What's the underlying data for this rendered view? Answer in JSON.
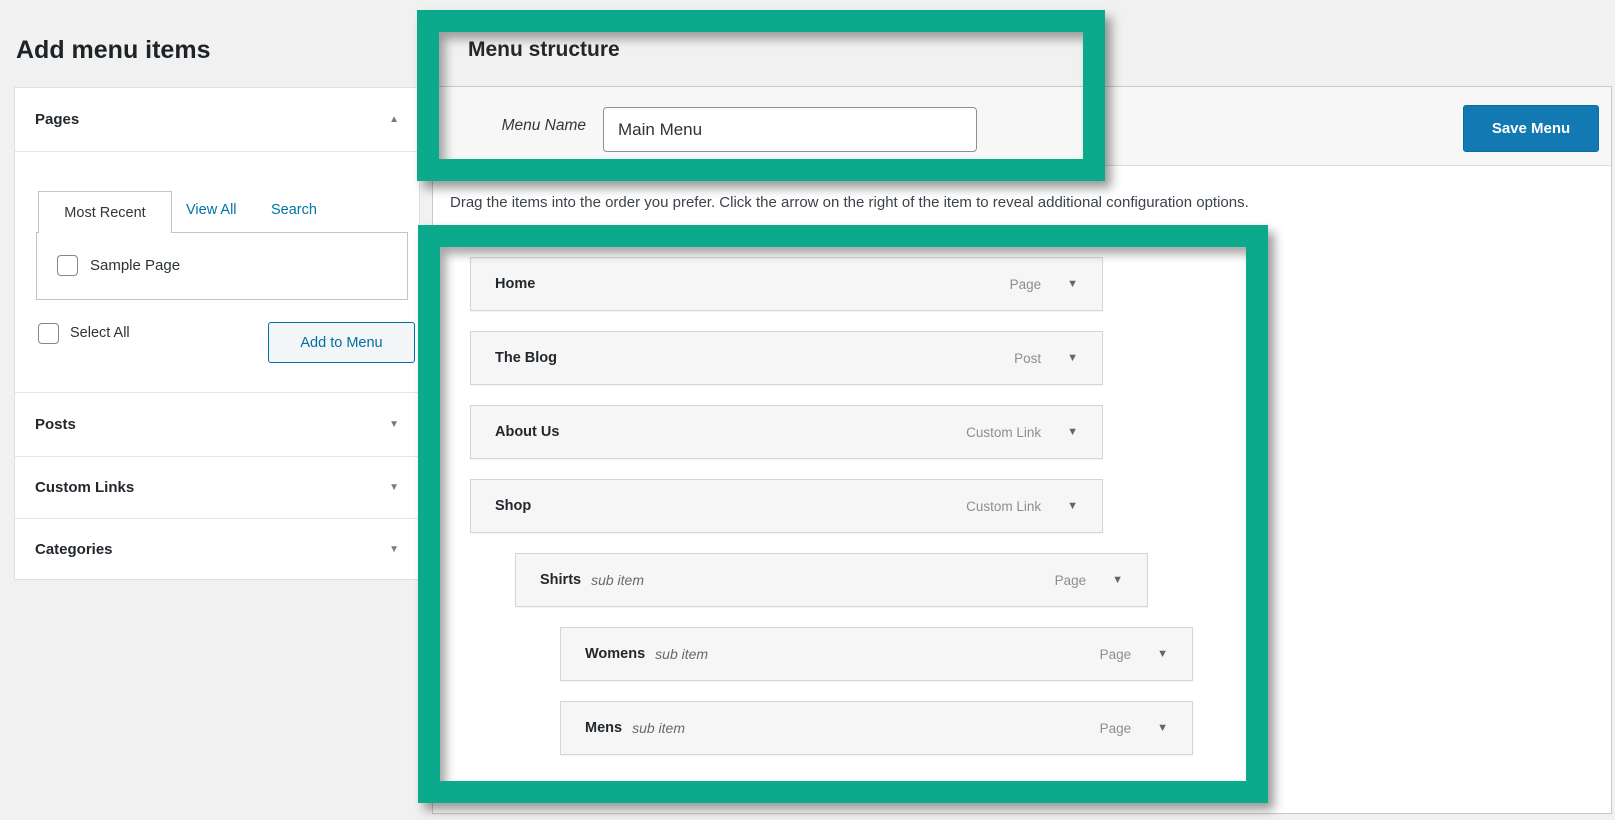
{
  "colors": {
    "highlight_green": "#0caa8c",
    "primary_button_blue": "#1279b2",
    "link_blue": "#0073aa",
    "secondary_button_blue": "#0071a1"
  },
  "left_panel": {
    "heading": "Add menu items",
    "tabs": {
      "most_recent": "Most Recent",
      "view_all": "View All",
      "search": "Search"
    },
    "pages_list": [
      {
        "label": "Sample Page",
        "checked": false
      }
    ],
    "select_all_label": "Select All",
    "add_to_menu_label": "Add to Menu",
    "sections": [
      {
        "label": "Pages",
        "arrow": "▲",
        "expanded": true
      },
      {
        "label": "Posts",
        "arrow": "▼",
        "expanded": false
      },
      {
        "label": "Custom Links",
        "arrow": "▼",
        "expanded": false
      },
      {
        "label": "Categories",
        "arrow": "▼",
        "expanded": false
      }
    ]
  },
  "menu_structure": {
    "heading": "Menu structure",
    "name_label": "Menu Name",
    "name_value": "Main Menu",
    "save_button": "Save Menu",
    "instruction": "Drag the items into the order you prefer. Click the arrow on the right of the item to reveal additional configuration options.",
    "items": [
      {
        "title": "Home",
        "type": "Page",
        "depth": 0,
        "arrow": "▼"
      },
      {
        "title": "The Blog",
        "type": "Post",
        "depth": 0,
        "arrow": "▼"
      },
      {
        "title": "About Us",
        "type": "Custom Link",
        "depth": 0,
        "arrow": "▼"
      },
      {
        "title": "Shop",
        "type": "Custom Link",
        "depth": 0,
        "arrow": "▼"
      },
      {
        "title": "Shirts",
        "sub_label": "sub item",
        "type": "Page",
        "depth": 1,
        "arrow": "▼"
      },
      {
        "title": "Womens",
        "sub_label": "sub item",
        "type": "Page",
        "depth": 2,
        "arrow": "▼"
      },
      {
        "title": "Mens",
        "sub_label": "sub item",
        "type": "Page",
        "depth": 2,
        "arrow": "▼"
      }
    ]
  }
}
